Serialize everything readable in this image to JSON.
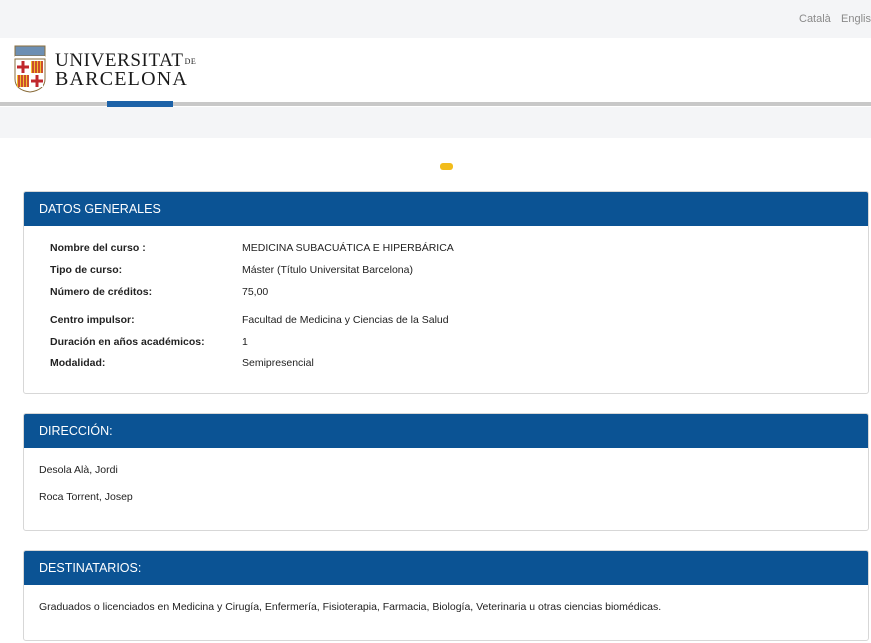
{
  "languages": [
    "Català",
    "English"
  ],
  "brand": {
    "line1_main": "UNIVERSITAT",
    "line1_de": "DE",
    "line2": "BARCELONA"
  },
  "datos_generales": {
    "title": "DATOS GENERALES",
    "rows": [
      {
        "label": "Nombre del curso :",
        "value": "MEDICINA SUBACUÁTICA E HIPERBÁRICA"
      },
      {
        "label": "Tipo de curso:",
        "value": "Máster (Título Universitat Barcelona)"
      },
      {
        "label": "Número de créditos:",
        "value": "75,00"
      },
      {
        "label": "Centro impulsor:",
        "value": "Facultad de Medicina y Ciencias de la Salud"
      },
      {
        "label": "Duración en años académicos:",
        "value": "1"
      },
      {
        "label": "Modalidad:",
        "value": "Semipresencial"
      }
    ]
  },
  "direccion": {
    "title": "DIRECCIÓN:",
    "people": [
      "Desola Alà, Jordi",
      "Roca Torrent, Josep"
    ]
  },
  "destinatarios": {
    "title": "DESTINATARIOS:",
    "text": "Graduados o licenciados en Medicina y Cirugía, Enfermería, Fisioterapia, Farmacia, Biología, Veterinaria u otras ciencias biomédicas."
  },
  "colors": {
    "header_blue": "#0b5394",
    "nav_active": "#1c62a8",
    "accent_yellow": "#f2bc1b"
  }
}
